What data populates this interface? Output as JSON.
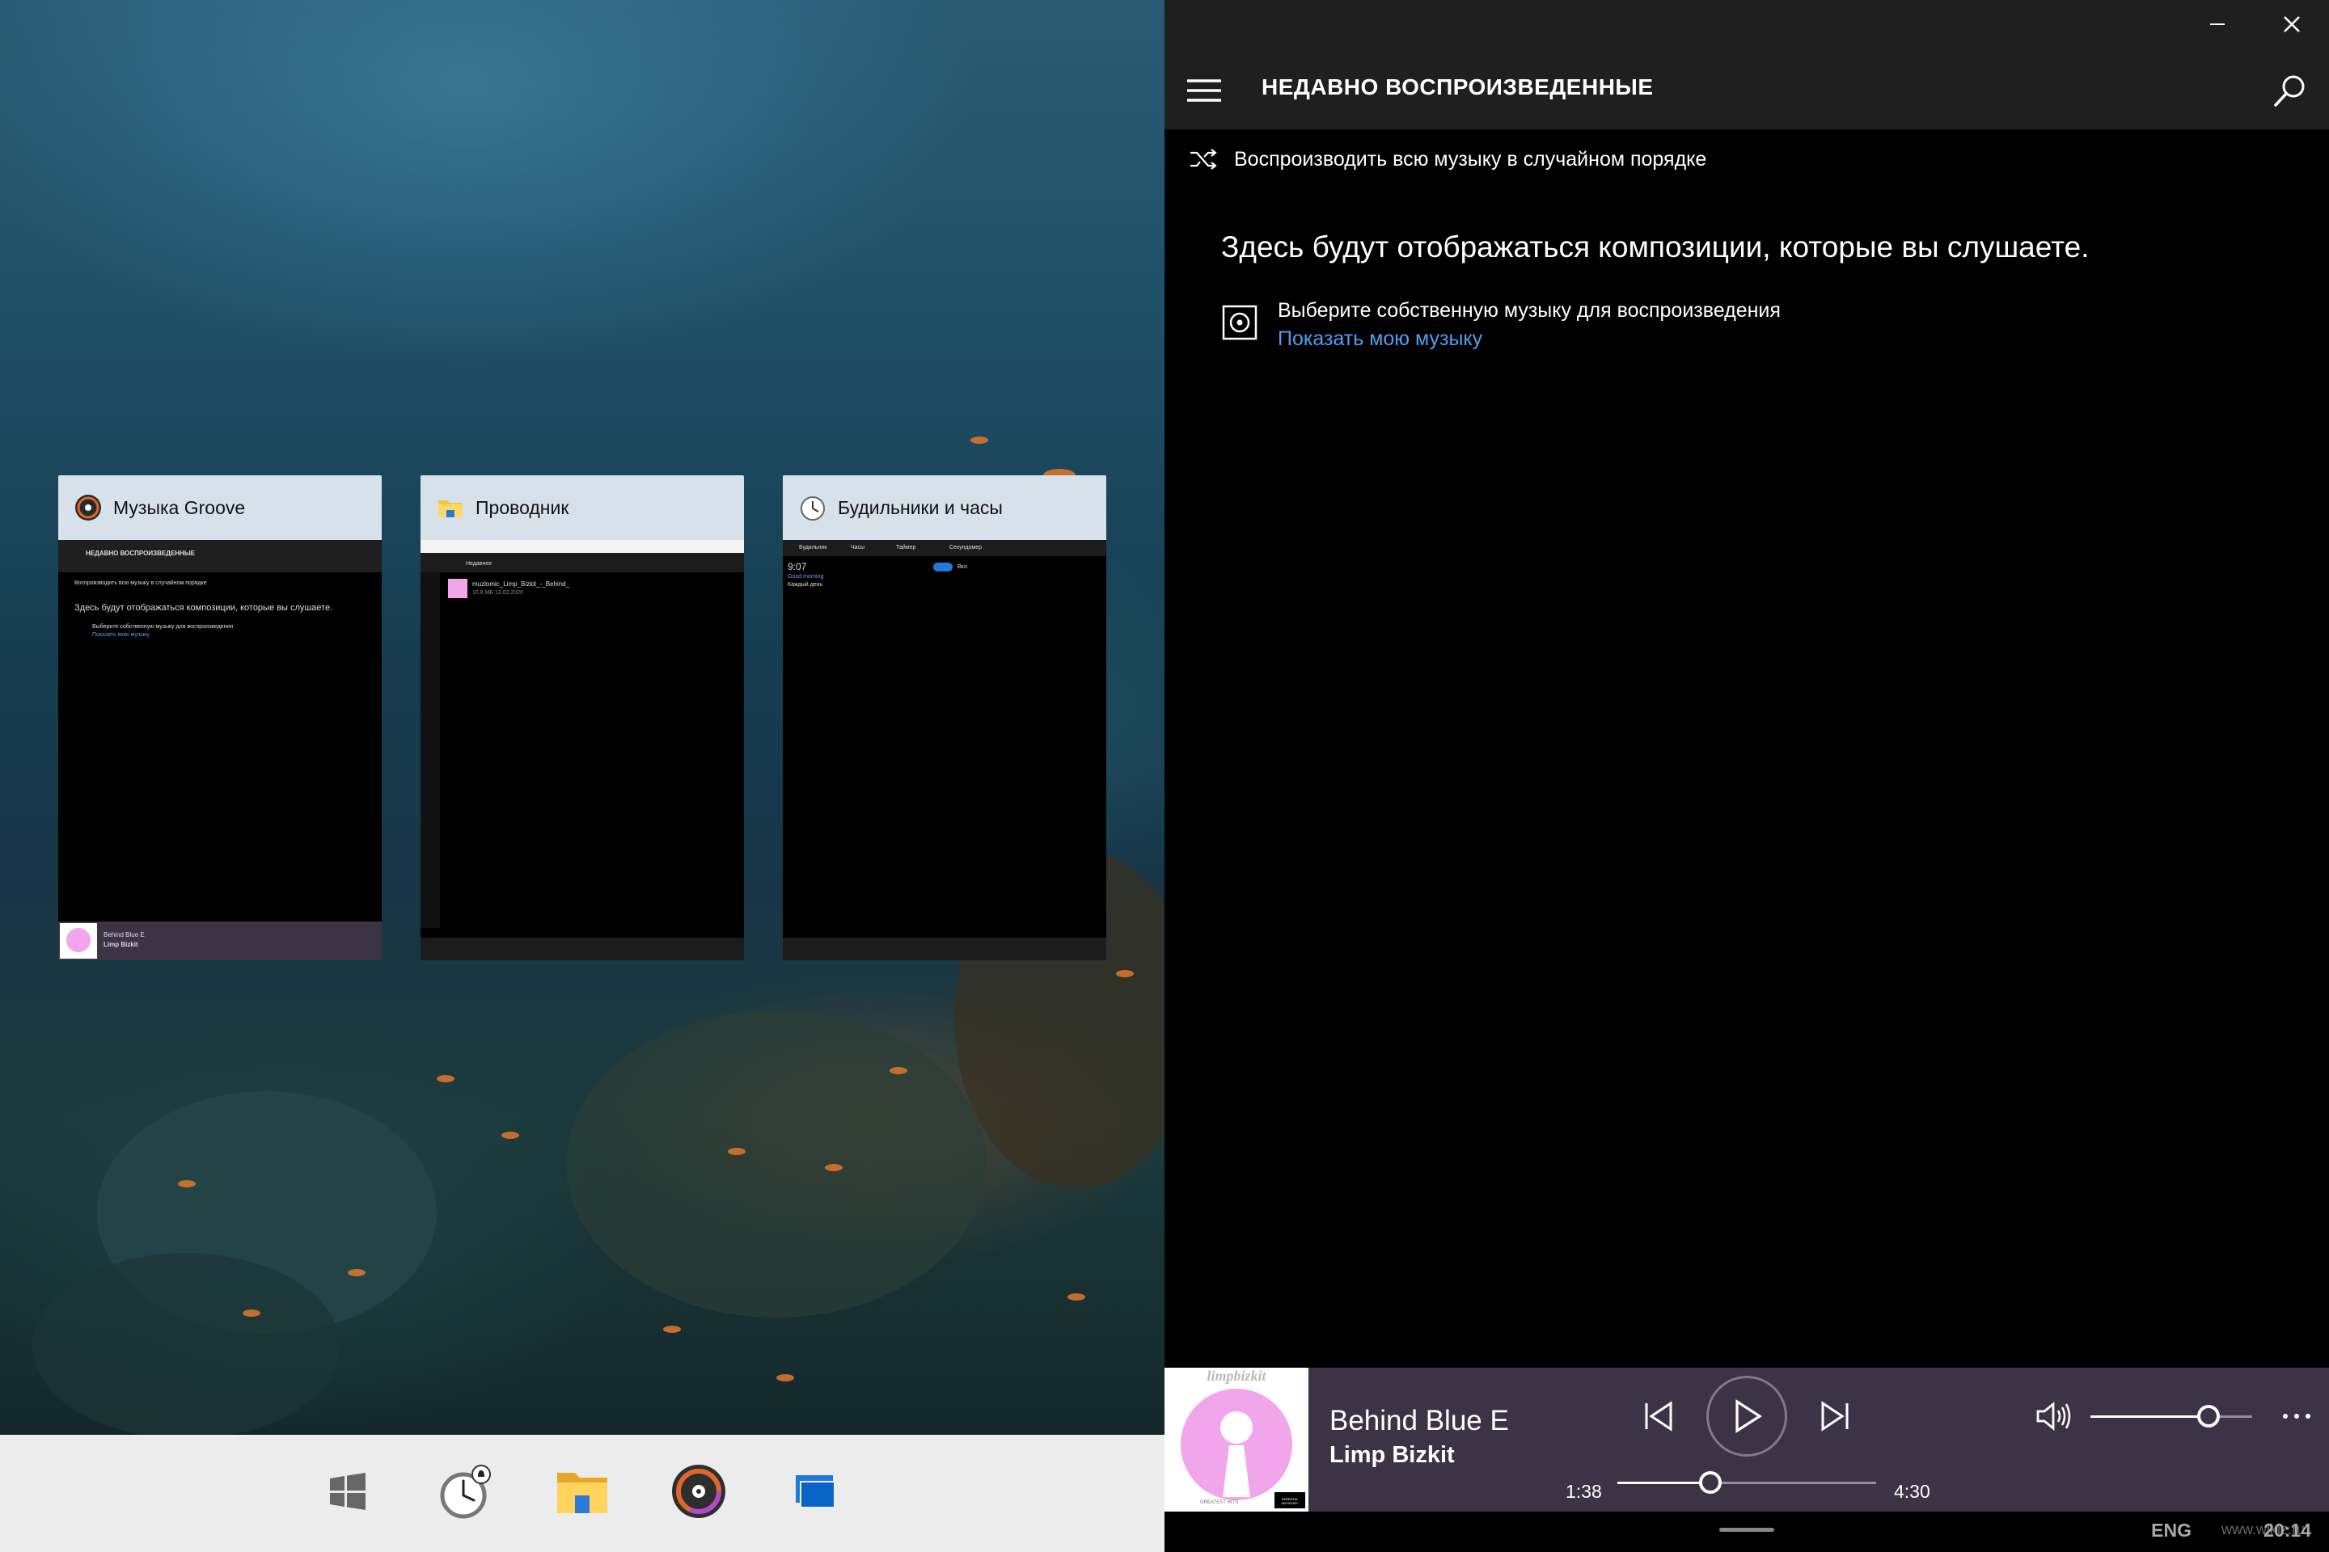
{
  "task_view": {
    "cards": [
      {
        "title": "Музыка Groove",
        "icon": "groove-music-icon"
      },
      {
        "title": "Проводник",
        "icon": "file-explorer-icon"
      },
      {
        "title": "Будильники и часы",
        "icon": "alarms-clock-icon"
      }
    ],
    "groove_thumb": {
      "header": "НЕДАВНО ВОСПРОИЗВЕДЕННЫЕ",
      "shuffle": "Воспроизводить всю музыку в случайном порядке",
      "empty": "Здесь будут отображаться композиции, которые вы слушаете.",
      "choose": "Выберите собственную музыку для воспроизведения",
      "link": "Показать мою музыку",
      "song": "Behind Blue E",
      "artist": "Limp Bizkit"
    },
    "explorer_thumb": {
      "nav": "Недавнее",
      "file": "muzlomic_Limp_Bizkit_-_Behind_",
      "meta": "10,8 МБ 12.02.2020"
    },
    "alarms_thumb": {
      "tabs": [
        "Будильник",
        "Часы",
        "Таймер",
        "Секундомер"
      ],
      "time": "9:07",
      "subtitle": "Good morning",
      "repeat": "Каждый день",
      "toggle_label": "Вкл."
    }
  },
  "taskbar": {
    "items": [
      "start-icon",
      "alarms-icon",
      "file-explorer-icon",
      "groove-icon",
      "task-view-icon"
    ]
  },
  "groove": {
    "page_title": "НЕДАВНО ВОСПРОИЗВЕДЕННЫЕ",
    "shuffle_all": "Воспроизводить всю музыку в случайном порядке",
    "empty_message": "Здесь будут отображаться композиции, которые вы слушаете.",
    "choose_music": "Выберите собственную музыку для воспроизведения",
    "show_my_music": "Показать мою музыку",
    "player": {
      "song_title": "Behind Blue E",
      "artist": "Limp Bizkit",
      "elapsed": "1:38",
      "duration": "4:30",
      "progress_fraction": 0.36,
      "volume_fraction": 0.73,
      "album_label": "limpbizkit",
      "album_footer": "GREATEST HITS",
      "advisory_label": "PARENTAL ADVISORY"
    }
  },
  "system": {
    "language": "ENG",
    "clock": "20:14",
    "watermark": "www.wikiz.ru"
  },
  "colors": {
    "accent_link": "#4f9ff0",
    "player_bg": "#3d3346",
    "title_bar": "#1f1f1f",
    "thumb_header": "#d6e1ea"
  }
}
